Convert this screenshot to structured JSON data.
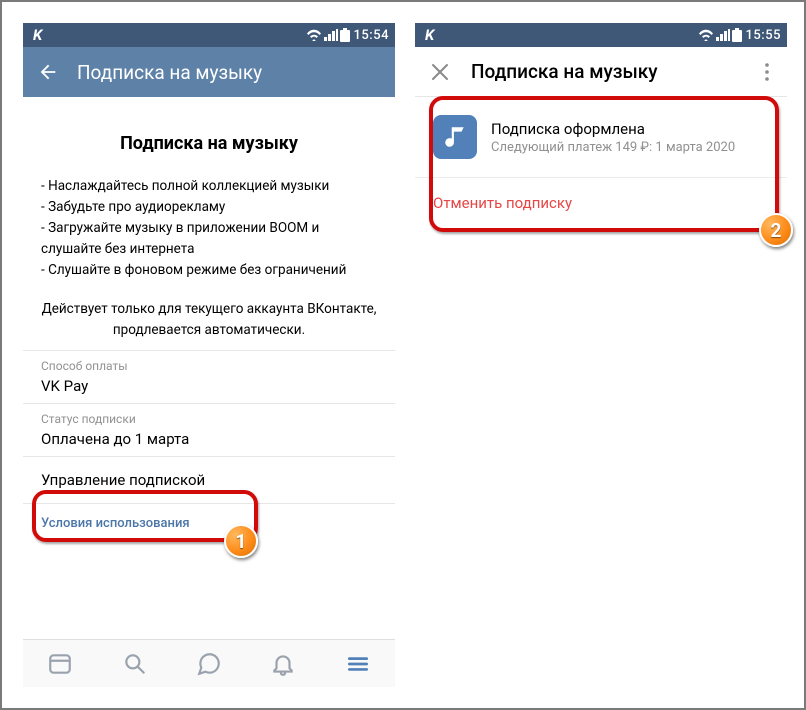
{
  "statusbar": {
    "app_letter": "K",
    "time_left": "15:54",
    "time_right": "15:55"
  },
  "left": {
    "header_title": "Подписка на музыку",
    "heading": "Подписка на музыку",
    "bullets": [
      "- Наслаждайтесь полной коллекцией музыки",
      "- Забудьте про аудиорекламу",
      "- Загружайте музыку в приложении BOOM и слушайте без интернета",
      "- Слушайте в фоновом режиме без ограничений"
    ],
    "note": "Действует только для текущего аккаунта ВКонтакте, продлевается автоматически.",
    "payment_label": "Способ оплаты",
    "payment_value": "VK Pay",
    "status_label": "Статус подписки",
    "status_value": "Оплачена до 1 марта",
    "manage": "Управление подпиской",
    "tos": "Условия использования"
  },
  "right": {
    "header_title": "Подписка на музыку",
    "sub_title": "Подписка оформлена",
    "sub_detail": "Следующий платеж 149 ₽: 1 марта 2020",
    "cancel": "Отменить подписку"
  },
  "badges": {
    "one": "1",
    "two": "2"
  }
}
